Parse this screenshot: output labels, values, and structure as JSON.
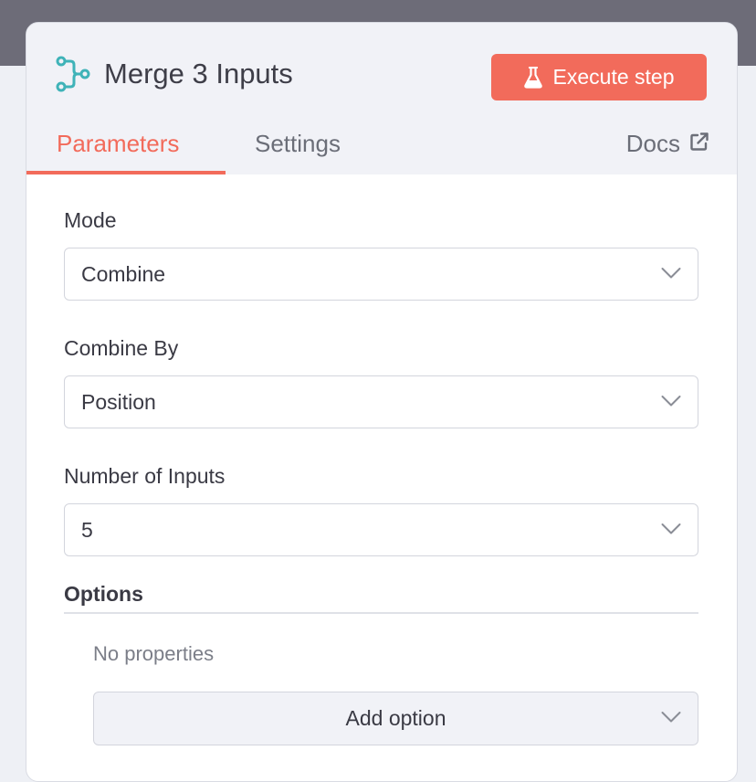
{
  "node": {
    "title": "Merge 3 Inputs",
    "icon": "merge-node-icon",
    "execute_label": "Execute step",
    "execute_icon": "flask-icon"
  },
  "tabs": {
    "parameters": "Parameters",
    "settings": "Settings",
    "active": "Parameters",
    "docs": "Docs",
    "docs_icon": "external-link-icon"
  },
  "fields": {
    "mode": {
      "label": "Mode",
      "value": "Combine"
    },
    "combine_by": {
      "label": "Combine By",
      "value": "Position"
    },
    "number_of_inputs": {
      "label": "Number of Inputs",
      "value": "5"
    }
  },
  "options": {
    "label": "Options",
    "empty_text": "No properties",
    "add_label": "Add option"
  },
  "colors": {
    "accent": "#f26b5b",
    "node_icon": "#3fb3b8",
    "topbar": "#6d6c78"
  }
}
